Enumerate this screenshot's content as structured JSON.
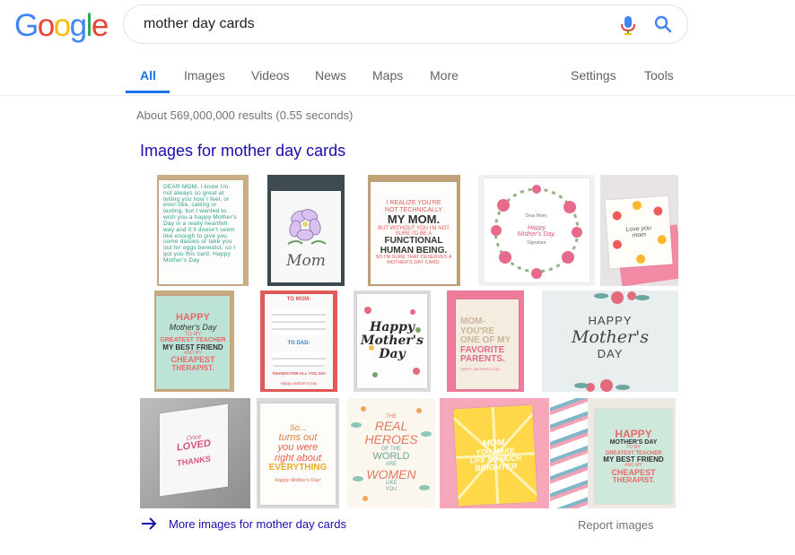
{
  "logo": [
    "G",
    "o",
    "o",
    "g",
    "l",
    "e"
  ],
  "search": {
    "value": "mother day cards"
  },
  "tabs": {
    "all": "All",
    "images": "Images",
    "videos": "Videos",
    "news": "News",
    "maps": "Maps",
    "more": "More",
    "settings": "Settings",
    "tools": "Tools"
  },
  "stats": "About 569,000,000 results (0.55 seconds)",
  "images_heading": "Images for mother day cards",
  "cards": {
    "c1": [
      "DEAR MOM, I know I'm not always so great at telling you how I feel, or even like, calling or texting, but I wanted to wish you a happy Mother's Day in a really heartfelt way and if it doesn't seem like enough to give you some daisies or take you out for eggs benedict, so I got you this card. Happy Mother's Day."
    ],
    "c2": "Mom",
    "c3": [
      "I REALIZE YOU'RE",
      "NOT TECHNICALLY",
      "MY MOM.",
      "BUT WITHOUT YOU I'M NOT SURE I'D BE A",
      "FUNCTIONAL",
      "HUMAN BEING.",
      "SO I'M SURE THAT DESERVES A MOTHER'S DAY CARD."
    ],
    "c4": [
      "Dear Mom,",
      "Happy",
      "Mother's Day,",
      "Signature"
    ],
    "c5": [
      "Love you",
      "mom"
    ],
    "c6": [
      "HAPPY",
      "Mother's Day",
      "TO MY",
      "GREATEST TEACHER",
      "MY BEST FRIEND",
      "AND MY",
      "CHEAPEST",
      "THERAPIST."
    ],
    "c7": [
      "TO MOM:",
      "TO DAD:",
      "THANKS FOR ALL YOU DO!",
      "Happy Mother's Day"
    ],
    "c8": [
      "Happy",
      "Mother's",
      "Day"
    ],
    "c9": [
      "MOM-",
      "YOU'RE",
      "ONE OF MY",
      "FAVORITE",
      "PARENTS.",
      "HAPPY MOTHER'S DAY"
    ],
    "c10": [
      "HAPPY",
      "Mother's",
      "DAY"
    ],
    "c11": [
      "Once",
      "LOVED",
      "THANKS"
    ],
    "c12": [
      "So...",
      "turns out",
      "you were",
      "right about",
      "EVERYTHING",
      "Happy Mother's Day!"
    ],
    "c13": [
      "THE",
      "REAL",
      "HEROES",
      "OF THE",
      "WORLD",
      "ARE",
      "WOMEN",
      "LIKE",
      "YOU"
    ],
    "c14": [
      "MOM,",
      "YOU MAKE",
      "LIFE SO MUCH",
      "BRIGHTER"
    ],
    "c15": [
      "HAPPY",
      "MOTHER'S DAY",
      "TO MY",
      "GREATEST TEACHER",
      "MY BEST FRIEND",
      "AND MY",
      "CHEAPEST",
      "THERAPIST."
    ]
  },
  "more_images_link": "More images for mother day cards",
  "report_images": "Report images",
  "colors": {
    "link": "#1a0dab",
    "accent": "#1a73e8",
    "text_muted": "#70757a"
  }
}
